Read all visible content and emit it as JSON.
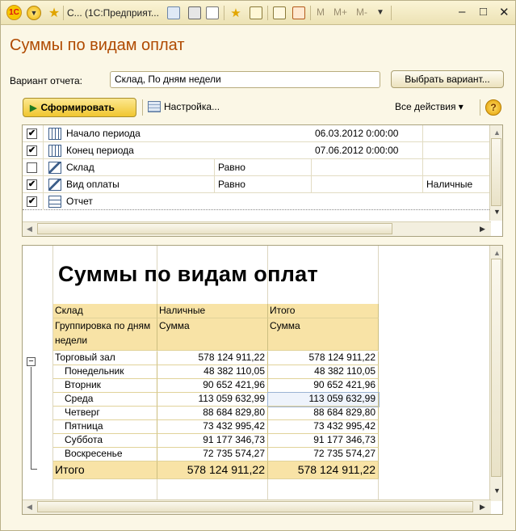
{
  "window": {
    "logo": "1С",
    "title": "С... (1С:Предприят...",
    "memory_buttons": [
      "M",
      "M+",
      "M-"
    ],
    "controls": {
      "minimize": "–",
      "restore": "□",
      "close": "✕"
    }
  },
  "form": {
    "heading": "Суммы по видам оплат",
    "variant_label": "Вариант отчета:",
    "variant_value": "Склад, По дням недели",
    "choose_variant_button": "Выбрать вариант...",
    "generate_button": "Сформировать",
    "settings_button": "Настройка...",
    "all_actions": "Все действия ▾",
    "help": "?"
  },
  "settings": {
    "rows": [
      {
        "checked": true,
        "icon": "calendar-icon",
        "name": "Начало периода",
        "condition": "",
        "value": "06.03.2012 0:00:00",
        "extra": ""
      },
      {
        "checked": true,
        "icon": "calendar-icon",
        "name": "Конец периода",
        "condition": "",
        "value": "07.06.2012 0:00:00",
        "extra": ""
      },
      {
        "checked": false,
        "icon": "filter-icon",
        "name": "Склад",
        "condition": "Равно",
        "value": "",
        "extra": ""
      },
      {
        "checked": true,
        "icon": "filter-icon",
        "name": "Вид оплаты",
        "condition": "Равно",
        "value": "",
        "extra": "Наличные"
      },
      {
        "checked": true,
        "icon": "table-icon",
        "name": "Отчет",
        "condition": "",
        "value": "",
        "extra": ""
      }
    ]
  },
  "report": {
    "title": "Суммы по видам оплат",
    "headers": {
      "col1_top": "Склад",
      "col1_bottom": "Группировка по дням недели",
      "col2_top": "Наличные",
      "col2_bottom": "Сумма",
      "col3_top": "Итого",
      "col3_bottom": "Сумма"
    },
    "rows": [
      {
        "label": "Торговый зал",
        "cash": "578 124 911,22",
        "total": "578 124 911,22",
        "level": 0
      },
      {
        "label": "Понедельник",
        "cash": "48 382 110,05",
        "total": "48 382 110,05",
        "level": 1
      },
      {
        "label": "Вторник",
        "cash": "90 652 421,96",
        "total": "90 652 421,96",
        "level": 1
      },
      {
        "label": "Среда",
        "cash": "113 059 632,99",
        "total": "113 059 632,99",
        "level": 1
      },
      {
        "label": "Четверг",
        "cash": "88 684 829,80",
        "total": "88 684 829,80",
        "level": 1
      },
      {
        "label": "Пятница",
        "cash": "73 432 995,42",
        "total": "73 432 995,42",
        "level": 1
      },
      {
        "label": "Суббота",
        "cash": "91 177 346,73",
        "total": "91 177 346,73",
        "level": 1
      },
      {
        "label": "Воскресенье",
        "cash": "72 735 574,27",
        "total": "72 735 574,27",
        "level": 1
      }
    ],
    "total_row": {
      "label": "Итого",
      "cash": "578 124 911,22",
      "total": "578 124 911,22"
    }
  }
}
